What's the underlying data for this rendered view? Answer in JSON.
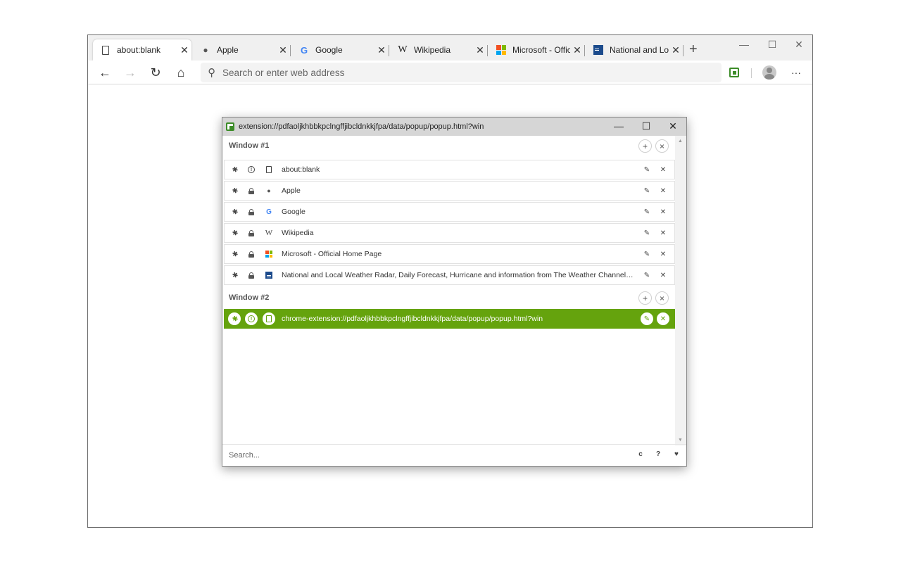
{
  "browser": {
    "tabs": [
      {
        "title": "about:blank",
        "icon": "page-icon",
        "close": "✕"
      },
      {
        "title": "Apple",
        "icon": "apple-icon",
        "close": "✕"
      },
      {
        "title": "Google",
        "icon": "google-icon",
        "close": "✕"
      },
      {
        "title": "Wikipedia",
        "icon": "wikipedia-icon",
        "close": "✕"
      },
      {
        "title": "Microsoft - Official",
        "icon": "microsoft-icon",
        "close": "✕"
      },
      {
        "title": "National and Local",
        "icon": "weather-channel-icon",
        "close": "✕"
      }
    ],
    "new_tab": "+",
    "window_controls": {
      "minimize": "—",
      "maximize": "☐",
      "close": "✕"
    },
    "address": {
      "placeholder": "Search or enter web address"
    },
    "more_menu": "···"
  },
  "popup": {
    "title": "extension://pdfaoljkhbbkpclngffjibcldnkkjfpa/data/popup/popup.html?win",
    "window_controls": {
      "minimize": "—",
      "maximize": "☐",
      "close": "✕"
    },
    "windows": [
      {
        "name": "Window #1",
        "add": "+",
        "close": "×",
        "tabs": [
          {
            "title": "about:blank",
            "status": "info",
            "favicon": "page"
          },
          {
            "title": "Apple",
            "status": "lock",
            "favicon": "apple"
          },
          {
            "title": "Google",
            "status": "lock",
            "favicon": "google"
          },
          {
            "title": "Wikipedia",
            "status": "lock",
            "favicon": "wikipedia"
          },
          {
            "title": "Microsoft - Official Home Page",
            "status": "lock",
            "favicon": "microsoft"
          },
          {
            "title": "National and Local Weather Radar, Daily Forecast, Hurricane and information from The Weather Channel an...",
            "status": "lock",
            "favicon": "weather"
          }
        ]
      },
      {
        "name": "Window #2",
        "add": "+",
        "close": "×",
        "tabs": [
          {
            "title": "chrome-extension://pdfaoljkhbbkpclngffjibcldnkkjfpa/data/popup/popup.html?win",
            "status": "info",
            "favicon": "page",
            "selected": true
          }
        ]
      }
    ],
    "footer": {
      "search_placeholder": "Search...",
      "refresh": "c",
      "help": "?",
      "heart": "♥"
    },
    "colors": {
      "selected_row": "#65a30d"
    }
  }
}
